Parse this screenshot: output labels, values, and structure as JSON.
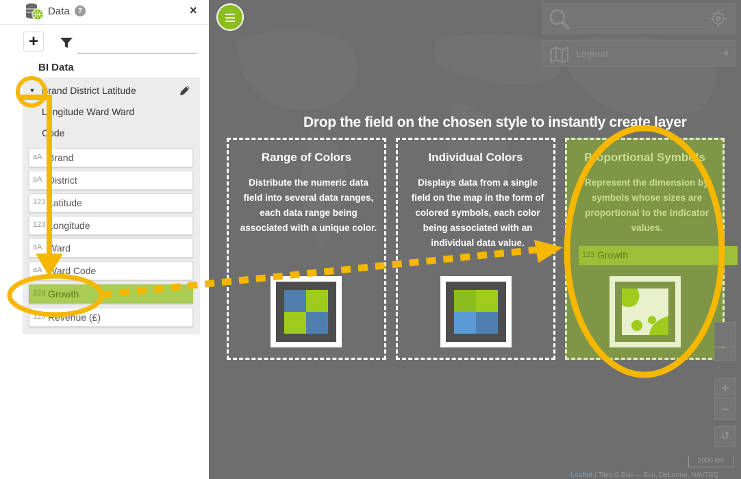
{
  "sidebar": {
    "title": "Data",
    "help": "?",
    "close": "×",
    "add": "+",
    "section": "BI Data",
    "hierarchy": [
      "Brand District Latitude",
      "Longitude Ward Ward",
      "Code"
    ],
    "fields": [
      {
        "type": "aA",
        "label": "Brand"
      },
      {
        "type": "aA",
        "label": "District"
      },
      {
        "type": "123",
        "label": "Latitude"
      },
      {
        "type": "123",
        "label": "Longitude"
      },
      {
        "type": "aA",
        "label": "Ward"
      },
      {
        "type": "aA",
        "label": "Ward Code"
      },
      {
        "type": "123",
        "label": "Growth"
      },
      {
        "type": "123",
        "label": "Revenue (£)"
      }
    ],
    "selected_field": "Growth"
  },
  "search": {
    "placeholder": "Search"
  },
  "legend": {
    "label": "Legend"
  },
  "instruction": "Drop the field on the chosen style to instantly create layer",
  "styles": [
    {
      "title": "Range of Colors",
      "description": "Distribute the numeric data field into several data ranges, each data range being associated with a unique color."
    },
    {
      "title": "Individual Colors",
      "description": "Displays data from a single field on the map in the form of colored symbols, each color being associated with an individual data value."
    },
    {
      "title": "Proportional Symbols",
      "description": "Represent the dimension by symbols whose sizes are proportional to the indicator values."
    }
  ],
  "dropped": {
    "type": "123",
    "label": "Growth"
  },
  "zoom": {
    "in": "+",
    "out": "−",
    "reset": "↺"
  },
  "scale": "2000 km",
  "attribution": {
    "leaflet": "Leaflet",
    "rest": " | Tiles © Esri — Esri, DeLorme, NAVTEQ"
  },
  "colors": {
    "accent": "#8bbd1f",
    "highlight": "#f5b700",
    "selected": "#a9cc55"
  }
}
